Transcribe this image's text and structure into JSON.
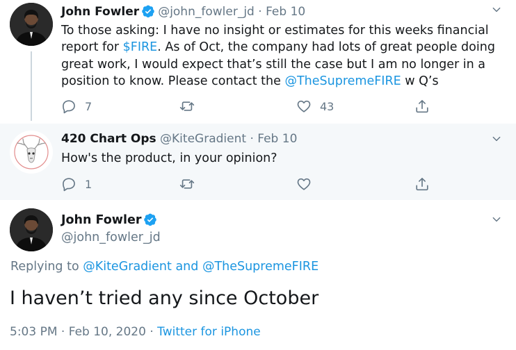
{
  "colors": {
    "link": "#1b95e0",
    "secondary": "#657786",
    "verified": "#1da1f2",
    "reply_bg": "#f5f8fa"
  },
  "tweet1": {
    "name": "John Fowler",
    "handle": "@john_fowler_jd",
    "sep": "·",
    "date": "Feb 10",
    "text_part1": "To those asking: I have no insight or estimates for this weeks financial report for ",
    "cashtag": "$FIRE",
    "text_part2": ".  As of Oct, the company had lots of great people doing great work, I would expect that’s still the case but I am no longer in a position to know.  Please contact the ",
    "mention": "@TheSupremeFIRE",
    "text_part3": " w Q’s",
    "replies": "7",
    "retweets": "",
    "likes": "43"
  },
  "tweet2": {
    "name": "420 Chart Ops",
    "handle": "@KiteGradient",
    "sep": "·",
    "date": "Feb 10",
    "text": "How's the product, in your opinion?",
    "replies": "1",
    "retweets": "",
    "likes": ""
  },
  "tweet3": {
    "name": "John Fowler",
    "handle": "@john_fowler_jd",
    "replying_prefix": "Replying to ",
    "replying_to_1": "@KiteGradient",
    "replying_and": " and ",
    "replying_to_2": "@TheSupremeFIRE",
    "text": "I haven’t tried any since October",
    "time": "5:03 PM",
    "sep1": " · ",
    "date": "Feb 10, 2020",
    "sep2": " · ",
    "source": "Twitter for iPhone"
  },
  "icons": [
    "verified-badge-icon",
    "chevron-down-icon",
    "reply-icon",
    "retweet-icon",
    "like-icon",
    "share-icon"
  ]
}
